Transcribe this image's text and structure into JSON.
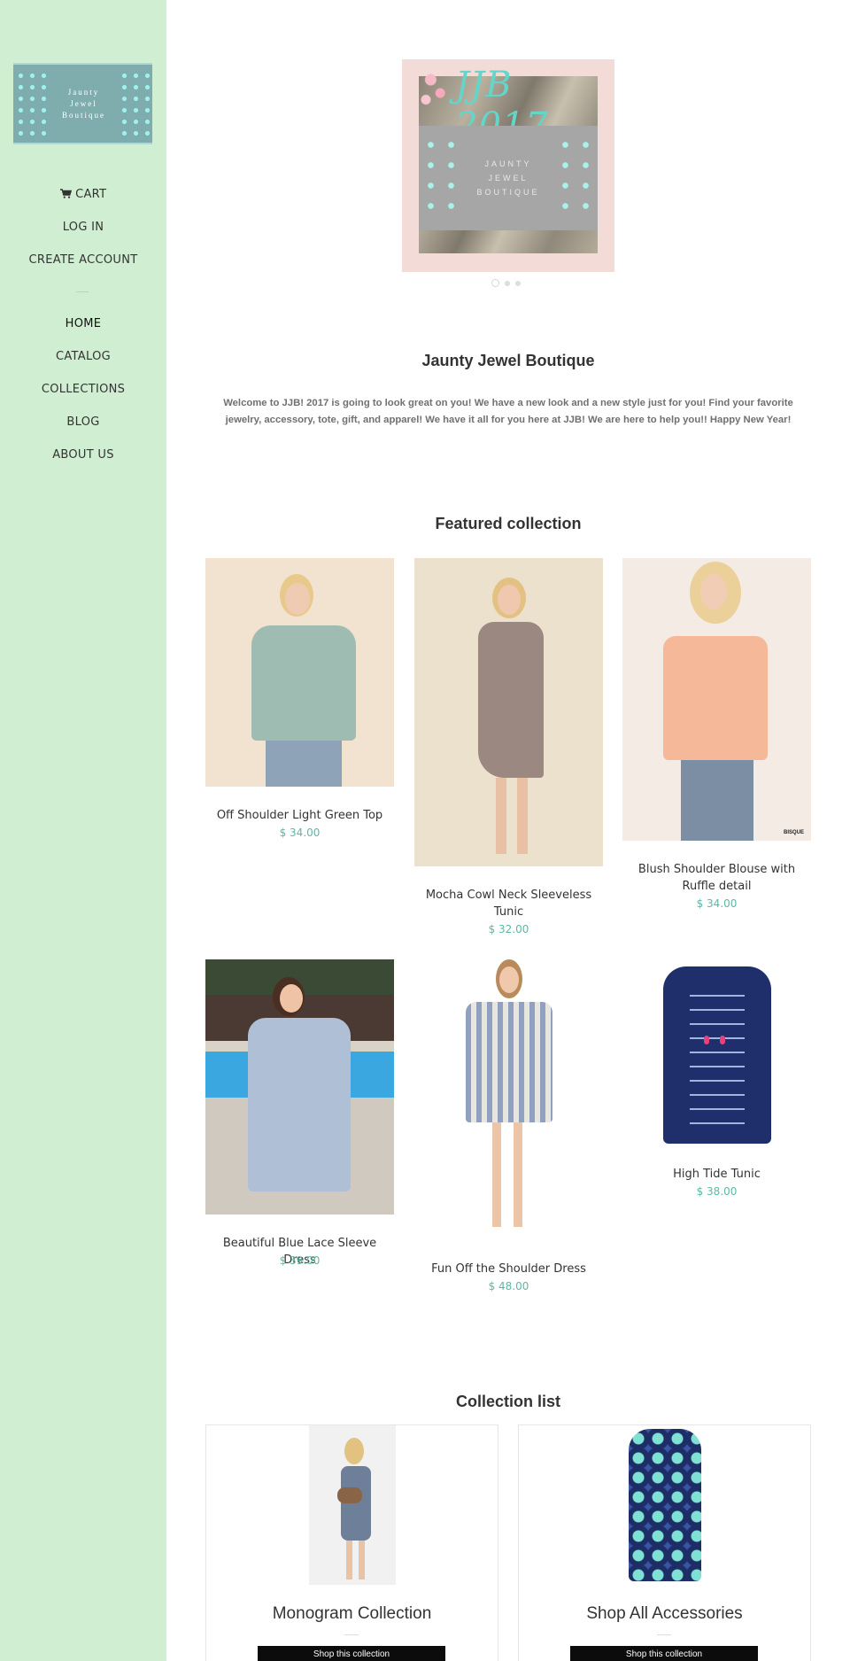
{
  "sidebar": {
    "logo_text": "Jaunty\nJewel\nBoutique",
    "nav": [
      {
        "label": "CART",
        "icon": "cart-icon"
      },
      {
        "label": "LOG IN"
      },
      {
        "label": "CREATE ACCOUNT"
      },
      {
        "label": "HOME",
        "active": true
      },
      {
        "label": "CATALOG"
      },
      {
        "label": "COLLECTIONS"
      },
      {
        "label": "BLOG"
      },
      {
        "label": "ABOUT US"
      }
    ]
  },
  "slideshow": {
    "script_title": "JJB 2017",
    "inner_text": "JAUNTY\nJEWEL\nBOUTIQUE",
    "current_slide": 1,
    "slide_count": 3
  },
  "store": {
    "title": "Jaunty Jewel Boutique",
    "welcome": "Welcome to JJB! 2017 is going to look great on you!  We have a new look and a new style just for you! Find your favorite jewelry, accessory, tote, gift, and apparel! We have it all for you here at JJB! We are here to help you!! Happy New Year!"
  },
  "featured": {
    "title": "Featured collection",
    "products": [
      {
        "name": "Off Shoulder Light Green Top",
        "price": "$ 34.00"
      },
      {
        "name": "Mocha Cowl Neck Sleeveless Tunic",
        "price": "$ 32.00"
      },
      {
        "name": "Blush Shoulder Blouse with Ruffle detail",
        "price": "$ 34.00",
        "image_tag": "BISQUE"
      },
      {
        "name": "Beautiful Blue Lace Sleeve Dress",
        "price": "$ 39.00"
      },
      {
        "name": "Fun Off the Shoulder Dress",
        "price": "$ 48.00"
      },
      {
        "name": "High Tide Tunic",
        "price": "$ 38.00"
      }
    ]
  },
  "collection_list": {
    "title": "Collection list",
    "items": [
      {
        "title": "Monogram Collection",
        "button": "Shop this collection"
      },
      {
        "title": "Shop All Accessories",
        "button": "Shop this collection"
      }
    ]
  },
  "colors": {
    "sidebar_bg": "#d0eed1",
    "price": "#5cb8a6",
    "button_bg": "#0c0c0c"
  }
}
